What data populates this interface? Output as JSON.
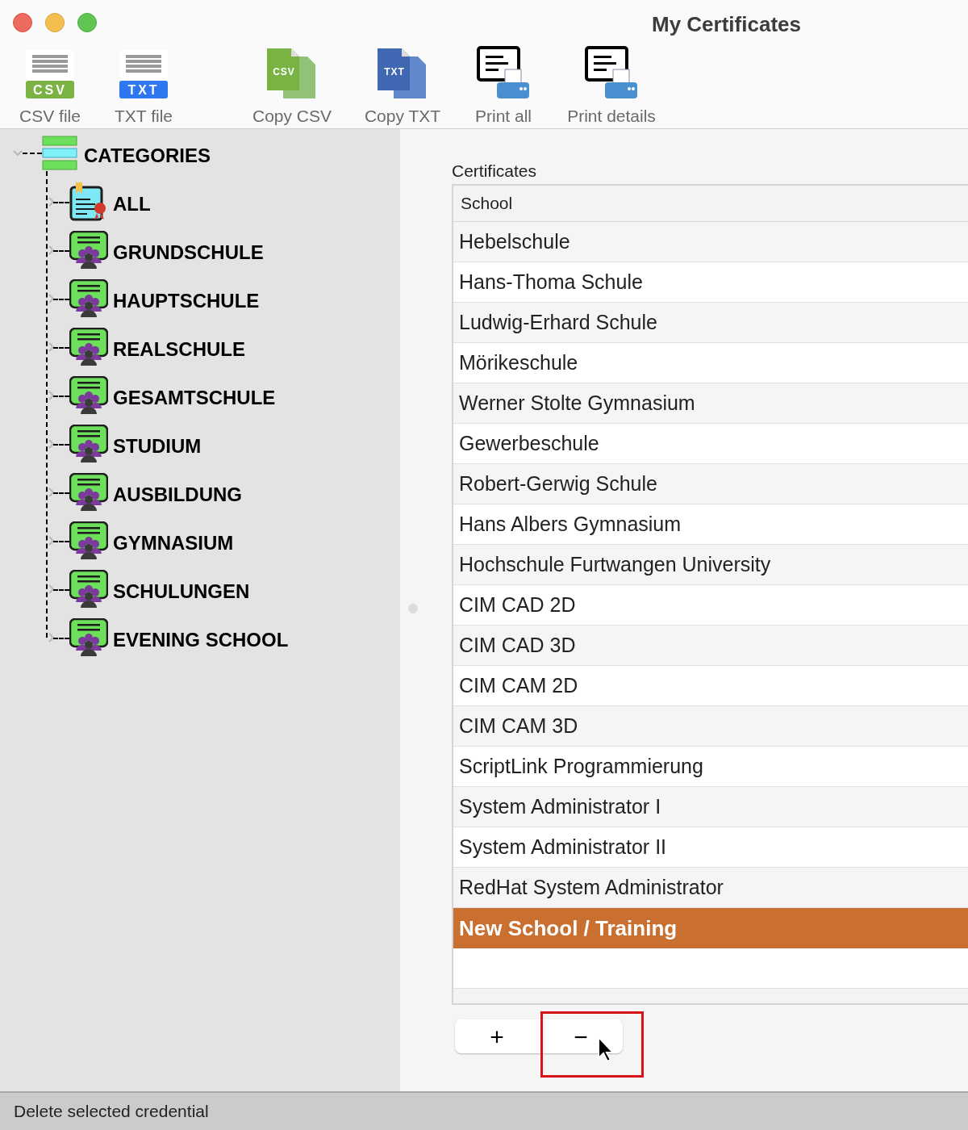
{
  "window": {
    "title": "My Certificates"
  },
  "toolbar": [
    {
      "kind": "csv-file",
      "label": "CSV file",
      "badge": "CSV"
    },
    {
      "kind": "txt-file",
      "label": "TXT file",
      "badge": "TXT"
    },
    {
      "kind": "copy-csv",
      "label": "Copy CSV",
      "badge": "CSV"
    },
    {
      "kind": "copy-txt",
      "label": "Copy TXT",
      "badge": "TXT"
    },
    {
      "kind": "print",
      "label": "Print all"
    },
    {
      "kind": "print",
      "label": "Print details"
    }
  ],
  "sidebar": {
    "root": {
      "label": "CATEGORIES",
      "expanded": true,
      "children": [
        {
          "label": "ALL",
          "kind": "all",
          "expanded": false
        },
        {
          "label": "GRUNDSCHULE",
          "kind": "group",
          "expanded": false
        },
        {
          "label": "HAUPTSCHULE",
          "kind": "group",
          "expanded": false
        },
        {
          "label": "REALSCHULE",
          "kind": "group",
          "expanded": false
        },
        {
          "label": "GESAMTSCHULE",
          "kind": "group",
          "expanded": false
        },
        {
          "label": "STUDIUM",
          "kind": "group",
          "expanded": false
        },
        {
          "label": "AUSBILDUNG",
          "kind": "group",
          "expanded": false
        },
        {
          "label": "GYMNASIUM",
          "kind": "group",
          "expanded": false
        },
        {
          "label": "SCHULUNGEN",
          "kind": "group",
          "expanded": false
        },
        {
          "label": "EVENING SCHOOL",
          "kind": "group",
          "expanded": false
        }
      ]
    }
  },
  "table": {
    "title": "Certificates",
    "columns": [
      "School"
    ],
    "rows": [
      {
        "school": "Hebelschule",
        "selected": false
      },
      {
        "school": "Hans-Thoma Schule",
        "selected": false
      },
      {
        "school": "Ludwig-Erhard Schule",
        "selected": false
      },
      {
        "school": "Mörikeschule",
        "selected": false
      },
      {
        "school": "Werner Stolte Gymnasium",
        "selected": false
      },
      {
        "school": "Gewerbeschule",
        "selected": false
      },
      {
        "school": "Robert-Gerwig Schule",
        "selected": false
      },
      {
        "school": "Hans Albers Gymnasium",
        "selected": false
      },
      {
        "school": "Hochschule Furtwangen University",
        "selected": false
      },
      {
        "school": "CIM CAD 2D",
        "selected": false
      },
      {
        "school": "CIM CAD 3D",
        "selected": false
      },
      {
        "school": "CIM CAM 2D",
        "selected": false
      },
      {
        "school": "CIM CAM 3D",
        "selected": false
      },
      {
        "school": "ScriptLink Programmierung",
        "selected": false
      },
      {
        "school": "System Administrator I",
        "selected": false
      },
      {
        "school": "System Administrator II",
        "selected": false
      },
      {
        "school": "RedHat System Administrator",
        "selected": false
      },
      {
        "school": "New School / Training",
        "selected": true
      }
    ]
  },
  "buttons": [
    {
      "label": "+",
      "highlighted": false
    },
    {
      "label": "−",
      "highlighted": true
    }
  ],
  "status_bar": "Delete selected credential"
}
